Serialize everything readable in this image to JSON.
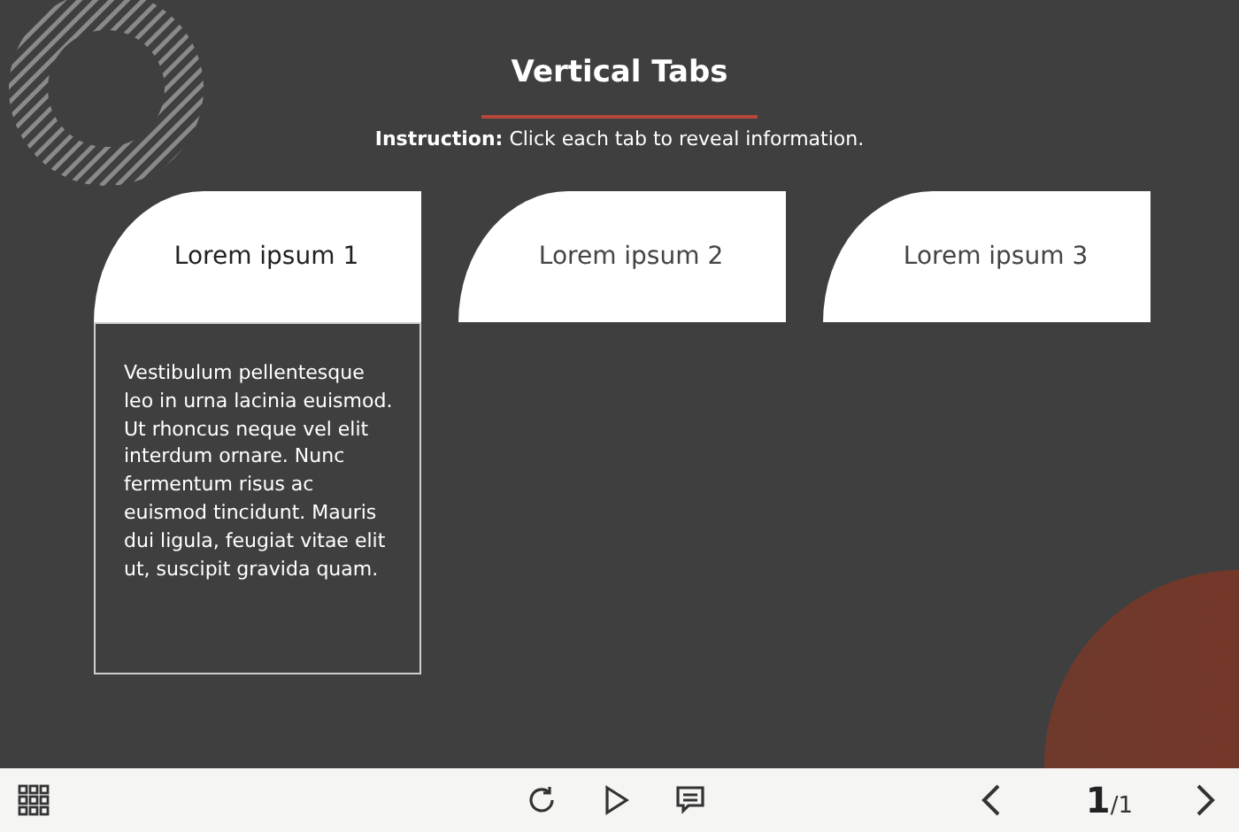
{
  "slide": {
    "title": "Vertical Tabs",
    "instruction": "**Instruction:** Click each tab to reveal information."
  },
  "tabs": [
    {
      "label": "Lorem ipsum 1",
      "selected": true,
      "content": "Vestibulum pellentesque leo in urna lacinia euismod. Ut rhoncus neque vel elit interdum ornare. Nunc fermentum risus ac euismod tincidunt. Mauris dui ligula, feugiat vitae elit ut, suscipit gravida quam."
    },
    {
      "label": "Lorem ipsum 2",
      "selected": false
    },
    {
      "label": "Lorem ipsum 3",
      "selected": false
    }
  ],
  "toolbar": {
    "page_current": "1",
    "page_total": "/1"
  }
}
